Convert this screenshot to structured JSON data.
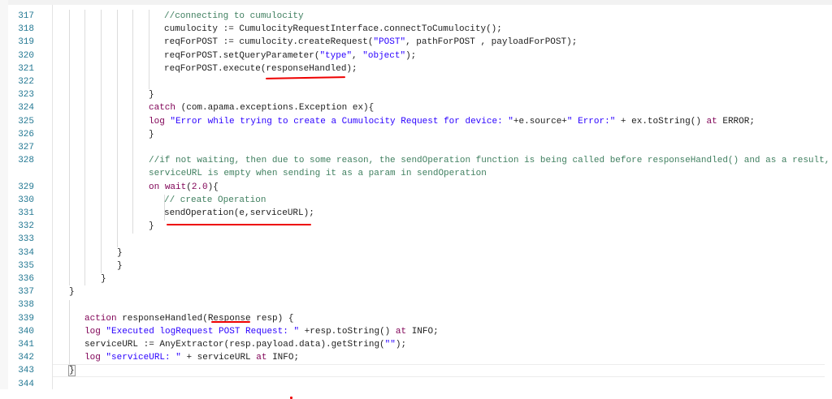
{
  "editor": {
    "lines": [
      {
        "num": "317",
        "tokens": [
          {
            "t": "//connecting to cumulocity",
            "c": "cm"
          }
        ]
      },
      {
        "num": "318",
        "tokens": [
          {
            "t": "cumulocity := CumulocityRequestInterface.connectToCumulocity();",
            "c": "pl"
          }
        ]
      },
      {
        "num": "319",
        "tokens": [
          {
            "t": "reqForPOST := cumulocity.createRequest(",
            "c": "pl"
          },
          {
            "t": "\"POST\"",
            "c": "st"
          },
          {
            "t": ", pathForPOST , payloadForPOST);",
            "c": "pl"
          }
        ]
      },
      {
        "num": "320",
        "tokens": [
          {
            "t": "reqForPOST.setQueryParameter(",
            "c": "pl"
          },
          {
            "t": "\"type\"",
            "c": "st"
          },
          {
            "t": ", ",
            "c": "pl"
          },
          {
            "t": "\"object\"",
            "c": "st"
          },
          {
            "t": ");",
            "c": "pl"
          }
        ]
      },
      {
        "num": "321",
        "tokens": [
          {
            "t": "reqForPOST.execute(responseHandled);",
            "c": "pl"
          }
        ]
      },
      {
        "num": "322",
        "tokens": []
      },
      {
        "num": "323",
        "tokens": [
          {
            "t": "}",
            "c": "pl"
          }
        ]
      },
      {
        "num": "324",
        "tokens": [
          {
            "t": "catch",
            "c": "kw"
          },
          {
            "t": " (com.apama.exceptions.Exception ex){",
            "c": "pl"
          }
        ]
      },
      {
        "num": "325",
        "tokens": [
          {
            "t": "log",
            "c": "kw"
          },
          {
            "t": " \"Error while trying to create a Cumulocity Request for device: \"",
            "c": "st"
          },
          {
            "t": "+e.source+",
            "c": "pl"
          },
          {
            "t": "\" Error:\"",
            "c": "st"
          },
          {
            "t": " + ex.toString() ",
            "c": "pl"
          },
          {
            "t": "at",
            "c": "kw"
          },
          {
            "t": " ERROR;",
            "c": "pl"
          }
        ]
      },
      {
        "num": "326",
        "tokens": [
          {
            "t": "}",
            "c": "pl"
          }
        ]
      },
      {
        "num": "327",
        "tokens": []
      },
      {
        "num": "328",
        "tokens": [
          {
            "t": "//if not waiting, then due to some reason, the sendOperation function is being called before responseHandled() and as a result,",
            "c": "cm"
          }
        ]
      },
      {
        "num": "",
        "tokens": [
          {
            "t": "serviceURL is empty when sending it as a param in sendOperation",
            "c": "cm"
          }
        ]
      },
      {
        "num": "329",
        "tokens": [
          {
            "t": "on",
            "c": "kw"
          },
          {
            "t": " ",
            "c": "pl"
          },
          {
            "t": "wait",
            "c": "kw"
          },
          {
            "t": "(",
            "c": "pl"
          },
          {
            "t": "2.0",
            "c": "nu"
          },
          {
            "t": "){",
            "c": "pl"
          }
        ]
      },
      {
        "num": "330",
        "tokens": [
          {
            "t": "// create Operation",
            "c": "cm"
          }
        ]
      },
      {
        "num": "331",
        "tokens": [
          {
            "t": "sendOperation(e,serviceURL);",
            "c": "pl"
          }
        ]
      },
      {
        "num": "332",
        "tokens": [
          {
            "t": "}",
            "c": "pl"
          }
        ]
      },
      {
        "num": "333",
        "tokens": []
      },
      {
        "num": "334",
        "tokens": [
          {
            "t": "}",
            "c": "pl"
          }
        ]
      },
      {
        "num": "335",
        "tokens": [
          {
            "t": "}",
            "c": "pl"
          }
        ]
      },
      {
        "num": "336",
        "tokens": [
          {
            "t": "}",
            "c": "pl"
          }
        ]
      },
      {
        "num": "337",
        "tokens": [
          {
            "t": "}",
            "c": "pl"
          }
        ]
      },
      {
        "num": "338",
        "tokens": []
      },
      {
        "num": "339",
        "tokens": [
          {
            "t": "action",
            "c": "kw"
          },
          {
            "t": " responseHandled(Response resp) {",
            "c": "pl"
          }
        ]
      },
      {
        "num": "340",
        "tokens": [
          {
            "t": "log",
            "c": "kw"
          },
          {
            "t": " \"Executed logRequest POST Request: \"",
            "c": "st"
          },
          {
            "t": " +resp.toString() ",
            "c": "pl"
          },
          {
            "t": "at",
            "c": "kw"
          },
          {
            "t": " INFO;",
            "c": "pl"
          }
        ]
      },
      {
        "num": "341",
        "tokens": [
          {
            "t": "serviceURL := AnyExtractor(resp.payload.data).getString(",
            "c": "pl"
          },
          {
            "t": "\"\"",
            "c": "st"
          },
          {
            "t": ");",
            "c": "pl"
          }
        ]
      },
      {
        "num": "342",
        "tokens": [
          {
            "t": "log",
            "c": "kw"
          },
          {
            "t": " \"serviceURL: \"",
            "c": "st"
          },
          {
            "t": " + serviceURL ",
            "c": "pl"
          },
          {
            "t": "at",
            "c": "kw"
          },
          {
            "t": " INFO;",
            "c": "pl"
          }
        ]
      },
      {
        "num": "343",
        "tokens": [
          {
            "t": "}",
            "c": "pl"
          }
        ]
      },
      {
        "num": "344",
        "tokens": []
      }
    ],
    "current_line": "343",
    "colors": {
      "comment": "#3f7f5f",
      "keyword": "#7f0055",
      "string": "#2a00ff",
      "line_number": "#237893",
      "annotation": "#e00000"
    }
  }
}
